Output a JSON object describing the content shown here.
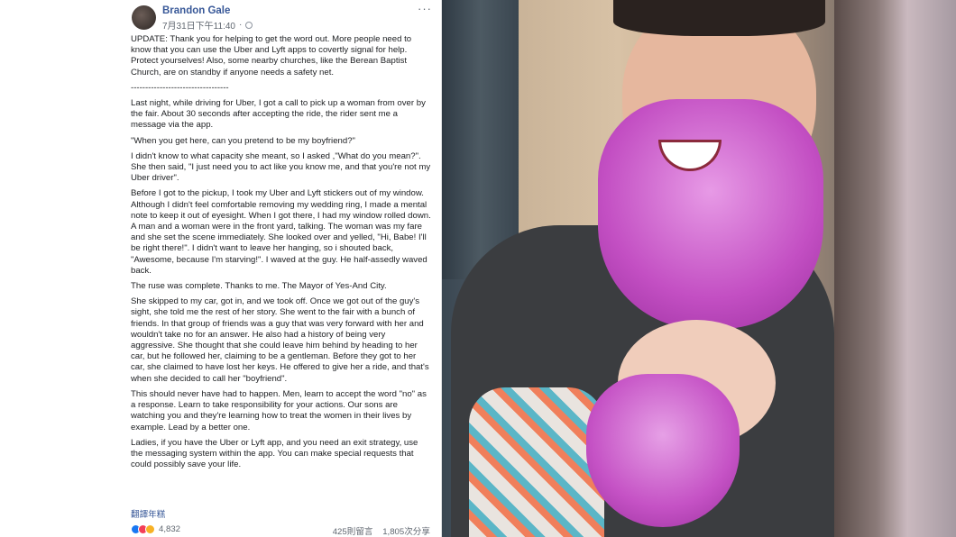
{
  "post": {
    "author": "Brandon Gale",
    "timestamp": "7月31日下午11:40",
    "more": "···",
    "paragraphs": [
      "UPDATE: Thank you for helping to get the word out. More people need to know that you can use the Uber and Lyft apps to covertly signal for help. Protect yourselves! Also, some nearby churches, like the Berean Baptist Church, are on standby if anyone needs a safety net.",
      "----------------------------------",
      "Last night, while driving for Uber, I got a call to pick up a woman from over by the fair. About 30 seconds after accepting the ride, the rider sent me a message via the app.",
      "\"When you get here, can you pretend to be my boyfriend?\"",
      "I didn't know to what capacity she meant, so I asked ,\"What do you mean?\". She then said, \"I just need you to act like you know me, and that you're not my Uber driver\".",
      "Before I got to the pickup, I took my Uber and Lyft stickers out of my window. Although I didn't feel comfortable removing my wedding ring, I made a mental note to keep it out of eyesight. When I got there, I had my window rolled down. A man and a woman were in the front yard, talking. The woman was my fare and she set the scene immediately. She looked over and yelled, \"Hi, Babe! I'll be right there!\". I didn't want to leave her hanging, so i shouted back, \"Awesome, because I'm starving!\". I waved at the guy. He half-assedly waved back.",
      "The ruse was complete. Thanks to me. The Mayor of Yes-And City.",
      "She skipped to my car, got in, and we took off. Once we got out of the guy's sight, she told me the rest of her story. She went to the fair with a bunch of friends. In that group of friends was a guy that was very forward with her and wouldn't take no for an answer. He also had a history of being very aggressive. She thought that she could leave him behind by heading to her car, but he followed her, claiming to be a gentleman. Before they got to her car, she claimed to have lost her keys. He offered to give her a ride, and that's when she decided to call her \"boyfriend\".",
      "This should never have had to happen. Men, learn to accept the word \"no\" as a response. Learn to take responsibility for your actions. Our sons are watching you and they're learning how to treat the women in their lives by example. Lead by a better one.",
      "Ladies, if you have the Uber or Lyft app, and you need an exit strategy, use the messaging system within the app. You can make special requests that could possibly save your life."
    ],
    "translate": "翻譯年糕",
    "reaction_count": "4,832",
    "comments": "425則留言",
    "shares": "1,805次分享"
  },
  "colors": {
    "link": "#385898",
    "like": "#1877f2",
    "love": "#f33e58",
    "wow": "#f7b125",
    "beard": "#c34fc3"
  }
}
